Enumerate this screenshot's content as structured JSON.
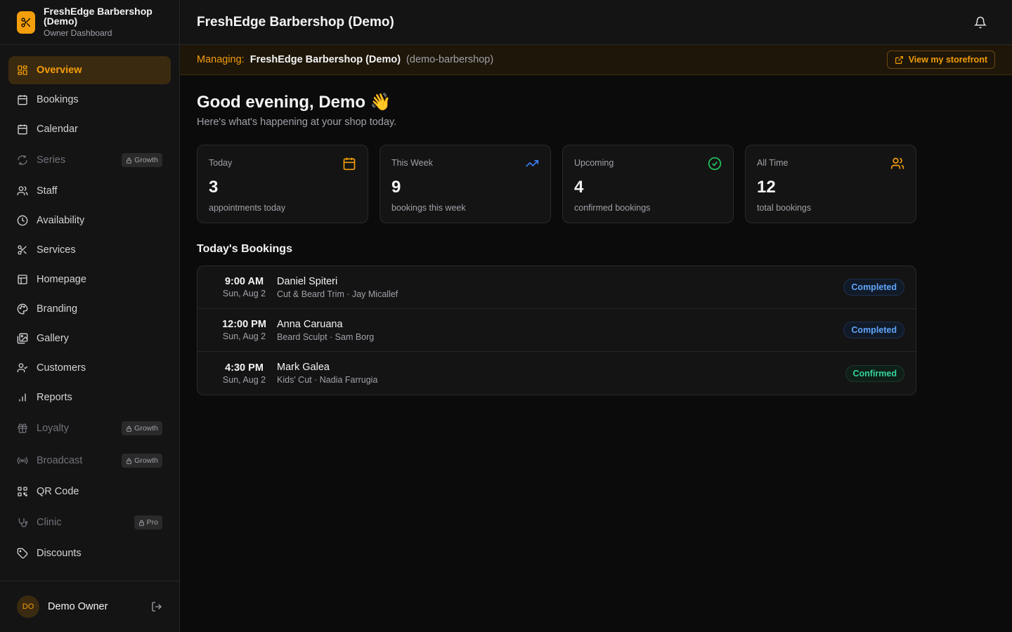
{
  "brand": {
    "name": "FreshEdge Barbershop (Demo)",
    "subtitle": "Owner Dashboard",
    "accent": "#f59e0b"
  },
  "sidebar": {
    "items": [
      {
        "label": "Overview",
        "icon": "grid-icon",
        "active": true
      },
      {
        "label": "Bookings",
        "icon": "calendar-days-icon"
      },
      {
        "label": "Calendar",
        "icon": "calendar-icon"
      },
      {
        "label": "Series",
        "icon": "repeat-icon",
        "badge": "Growth",
        "locked": true
      },
      {
        "label": "Staff",
        "icon": "users-icon"
      },
      {
        "label": "Availability",
        "icon": "clock-icon"
      },
      {
        "label": "Services",
        "icon": "scissors-icon"
      },
      {
        "label": "Homepage",
        "icon": "layout-icon"
      },
      {
        "label": "Branding",
        "icon": "palette-icon"
      },
      {
        "label": "Gallery",
        "icon": "images-icon"
      },
      {
        "label": "Customers",
        "icon": "user-check-icon"
      },
      {
        "label": "Reports",
        "icon": "bar-chart-icon"
      },
      {
        "label": "Loyalty",
        "icon": "gift-icon",
        "badge": "Growth",
        "locked": true
      },
      {
        "label": "Broadcast",
        "icon": "radio-icon",
        "badge": "Growth",
        "locked": true
      },
      {
        "label": "QR Code",
        "icon": "qr-code-icon"
      },
      {
        "label": "Clinic",
        "icon": "stethoscope-icon",
        "badge": "Pro",
        "locked": true
      },
      {
        "label": "Discounts",
        "icon": "tag-icon"
      }
    ]
  },
  "user": {
    "initials": "DO",
    "name": "Demo Owner"
  },
  "header": {
    "title": "FreshEdge Barbershop (Demo)"
  },
  "managing": {
    "label": "Managing:",
    "name": "FreshEdge Barbershop (Demo)",
    "slug": "(demo-barbershop)",
    "button": "View my storefront"
  },
  "greeting": {
    "title": "Good evening, Demo 👋",
    "subtitle": "Here's what's happening at your shop today."
  },
  "stats": [
    {
      "label": "Today",
      "value": "3",
      "desc": "appointments today",
      "icon": "calendar-icon",
      "color": "#f59e0b"
    },
    {
      "label": "This Week",
      "value": "9",
      "desc": "bookings this week",
      "icon": "trending-up-icon",
      "color": "#3b82f6"
    },
    {
      "label": "Upcoming",
      "value": "4",
      "desc": "confirmed bookings",
      "icon": "check-circle-icon",
      "color": "#22c55e"
    },
    {
      "label": "All Time",
      "value": "12",
      "desc": "total bookings",
      "icon": "users-icon",
      "color": "#f59e0b"
    }
  ],
  "todays_bookings": {
    "title": "Today's Bookings",
    "rows": [
      {
        "time": "9:00 AM",
        "date": "Sun, Aug 2",
        "customer": "Daniel Spiteri",
        "detail": "Cut & Beard Trim · Jay Micallef",
        "status": "Completed"
      },
      {
        "time": "12:00 PM",
        "date": "Sun, Aug 2",
        "customer": "Anna Caruana",
        "detail": "Beard Sculpt · Sam Borg",
        "status": "Completed"
      },
      {
        "time": "4:30 PM",
        "date": "Sun, Aug 2",
        "customer": "Mark Galea",
        "detail": "Kids' Cut · Nadia Farrugia",
        "status": "Confirmed"
      }
    ]
  }
}
